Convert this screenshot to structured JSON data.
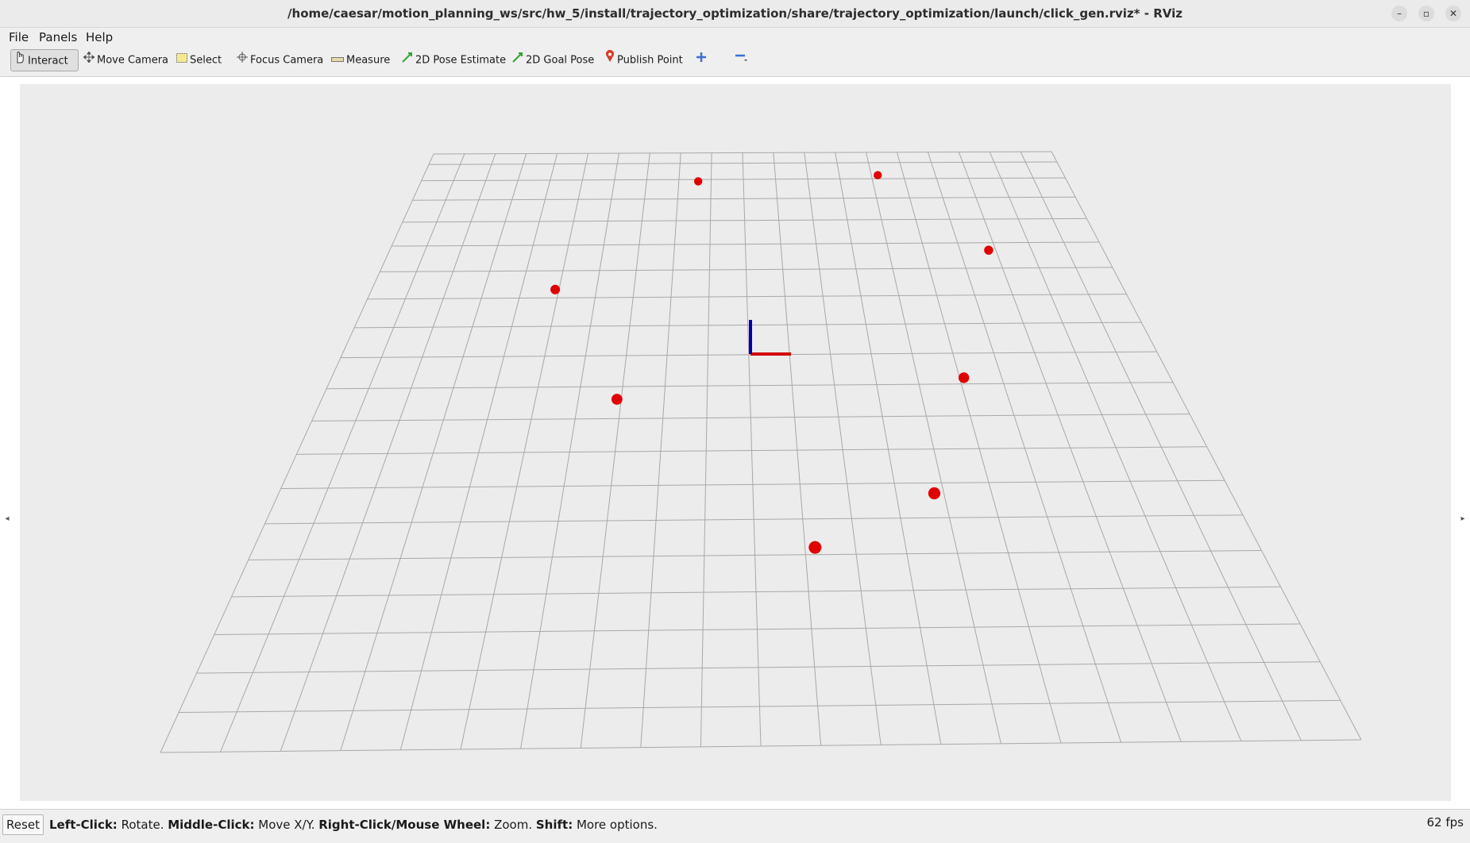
{
  "window": {
    "title": "/home/caesar/motion_planning_ws/src/hw_5/install/trajectory_optimization/share/trajectory_optimization/launch/click_gen.rviz* - RViz",
    "controls": [
      {
        "name": "minimize",
        "glyph": "–"
      },
      {
        "name": "maximize",
        "glyph": "▫"
      },
      {
        "name": "close",
        "glyph": "✕"
      }
    ]
  },
  "menu": [
    {
      "label": "File"
    },
    {
      "label": "Panels"
    },
    {
      "label": "Help"
    }
  ],
  "toolbar": {
    "tools": [
      {
        "label": "Interact",
        "icon": "hand-icon",
        "active": true
      },
      {
        "label": "Move Camera",
        "icon": "move-icon",
        "active": false
      },
      {
        "label": "Select",
        "icon": "select-icon",
        "active": false
      },
      {
        "label": "Focus Camera",
        "icon": "focus-icon",
        "active": false
      },
      {
        "label": "Measure",
        "icon": "ruler-icon",
        "active": false
      },
      {
        "label": "2D Pose Estimate",
        "icon": "green-arrow-icon",
        "active": false
      },
      {
        "label": "2D Goal Pose",
        "icon": "green-arrow-icon",
        "active": false
      },
      {
        "label": "Publish Point",
        "icon": "map-pin-icon",
        "active": false
      }
    ],
    "add_tool_icon": "plus-icon",
    "remove_tool_icon": "minus-icon"
  },
  "scene": {
    "background_color": "#ececec",
    "grid_color": "#a8a8a8",
    "point_color": "#e00000",
    "axis_colors": {
      "x": "#d40000",
      "z": "#0000b4"
    },
    "grid_cells": 20,
    "points_grid_coords": [
      [
        8.6,
        2.1
      ],
      [
        14.2,
        1.8
      ],
      [
        16.8,
        5.3
      ],
      [
        4.9,
        6.7
      ],
      [
        15.1,
        9.8
      ],
      [
        6.9,
        10.4
      ],
      [
        13.8,
        13.3
      ],
      [
        11.2,
        14.8
      ]
    ]
  },
  "statusbar": {
    "reset_label": "Reset",
    "help": [
      {
        "key": "Left-Click:",
        "text": " Rotate. "
      },
      {
        "key": "Middle-Click:",
        "text": " Move X/Y. "
      },
      {
        "key": "Right-Click/Mouse Wheel:",
        "text": " Zoom. "
      },
      {
        "key": "Shift:",
        "text": " More options."
      }
    ],
    "fps": "62 fps"
  }
}
